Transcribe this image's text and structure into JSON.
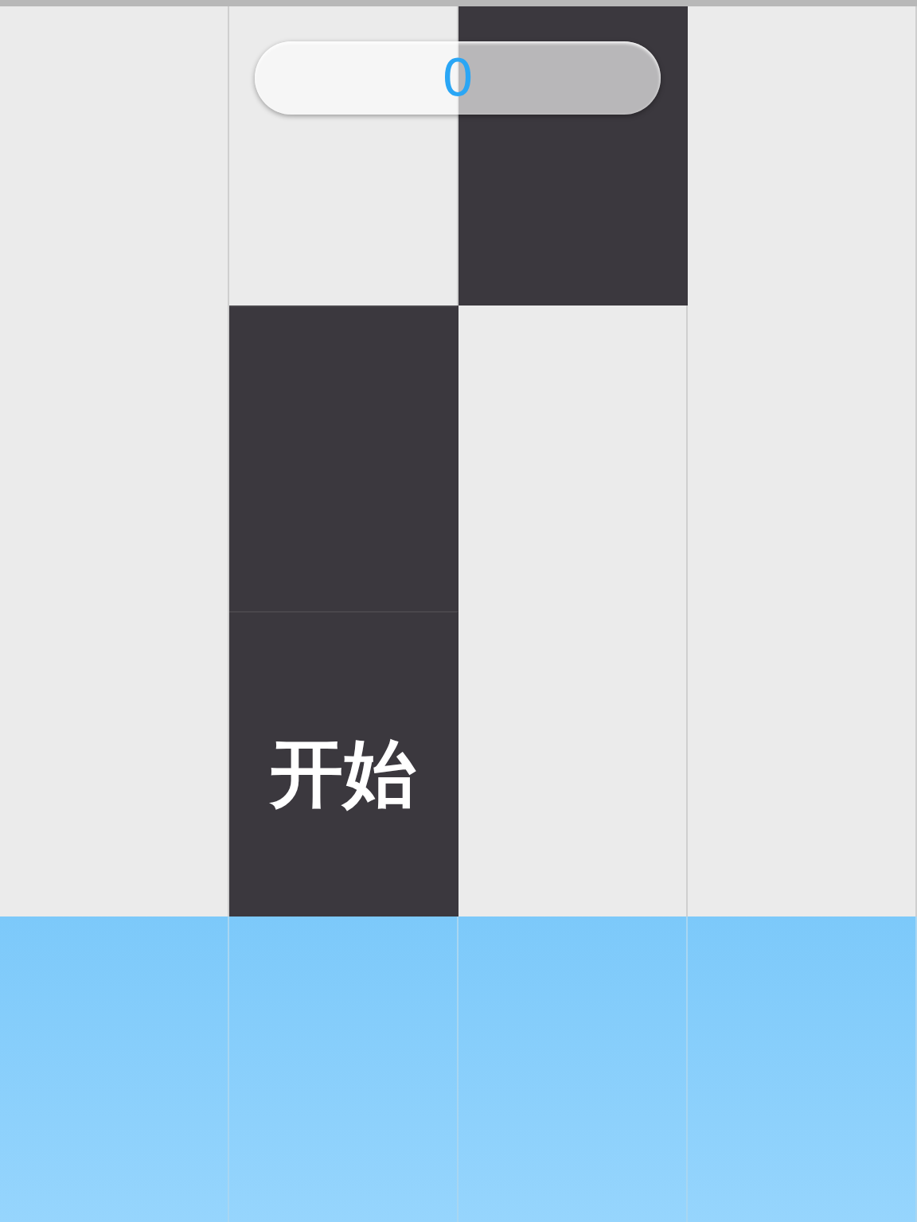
{
  "score": "0",
  "rows": [
    {
      "tiles": [
        {
          "kind": "white"
        },
        {
          "kind": "white"
        },
        {
          "kind": "black"
        },
        {
          "kind": "white"
        }
      ]
    },
    {
      "tiles": [
        {
          "kind": "white"
        },
        {
          "kind": "black"
        },
        {
          "kind": "white"
        },
        {
          "kind": "white"
        }
      ]
    },
    {
      "tiles": [
        {
          "kind": "white"
        },
        {
          "kind": "black",
          "label": "开始"
        },
        {
          "kind": "white"
        },
        {
          "kind": "white"
        }
      ]
    },
    {
      "tiles": [
        {
          "kind": "blue"
        },
        {
          "kind": "blue"
        },
        {
          "kind": "blue"
        },
        {
          "kind": "blue"
        }
      ]
    }
  ]
}
